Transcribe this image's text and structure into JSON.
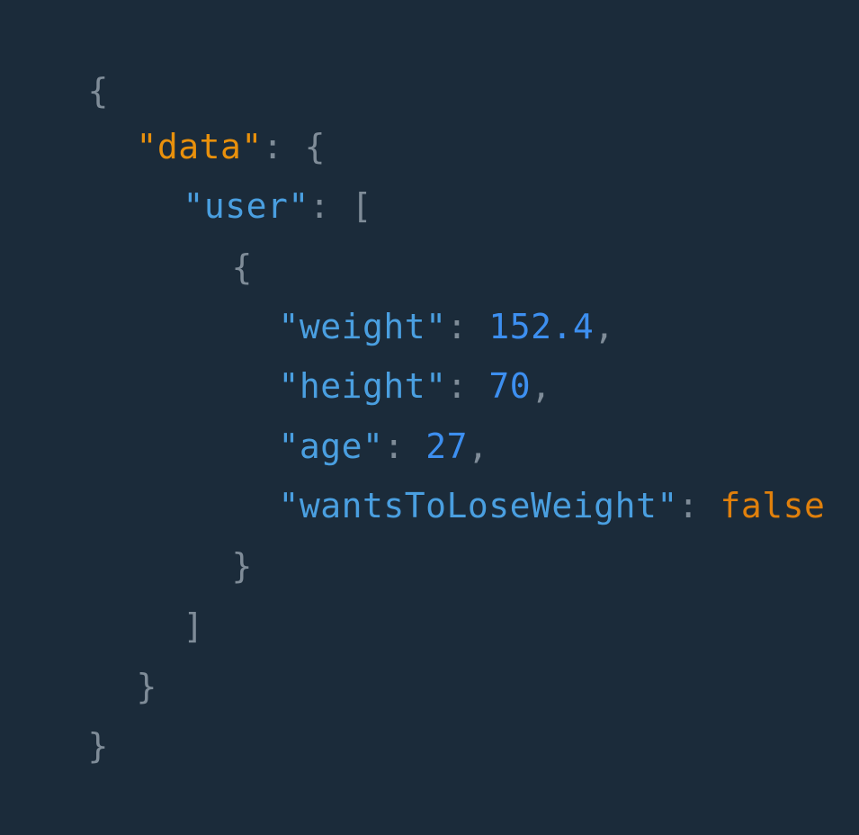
{
  "theme": {
    "background": "#1b2b3a",
    "punctuation": "#7f8c98",
    "top_key": "#e8900c",
    "key": "#4a9fe0",
    "number": "#3d8ff0",
    "boolean": "#e0800c"
  },
  "json": {
    "open_root": "{",
    "data_key": "\"data\"",
    "colon": ":",
    "open_data": "{",
    "user_key": "\"user\"",
    "open_array": "[",
    "open_obj": "{",
    "fields": [
      {
        "key": "\"weight\"",
        "value": "152.4",
        "value_type": "number",
        "trail": ","
      },
      {
        "key": "\"height\"",
        "value": "70",
        "value_type": "number",
        "trail": ","
      },
      {
        "key": "\"age\"",
        "value": "27",
        "value_type": "number",
        "trail": ","
      },
      {
        "key": "\"wantsToLoseWeight\"",
        "value": "false",
        "value_type": "boolean",
        "trail": ""
      }
    ],
    "close_obj": "}",
    "close_array": "]",
    "close_data": "}",
    "close_root": "}"
  }
}
